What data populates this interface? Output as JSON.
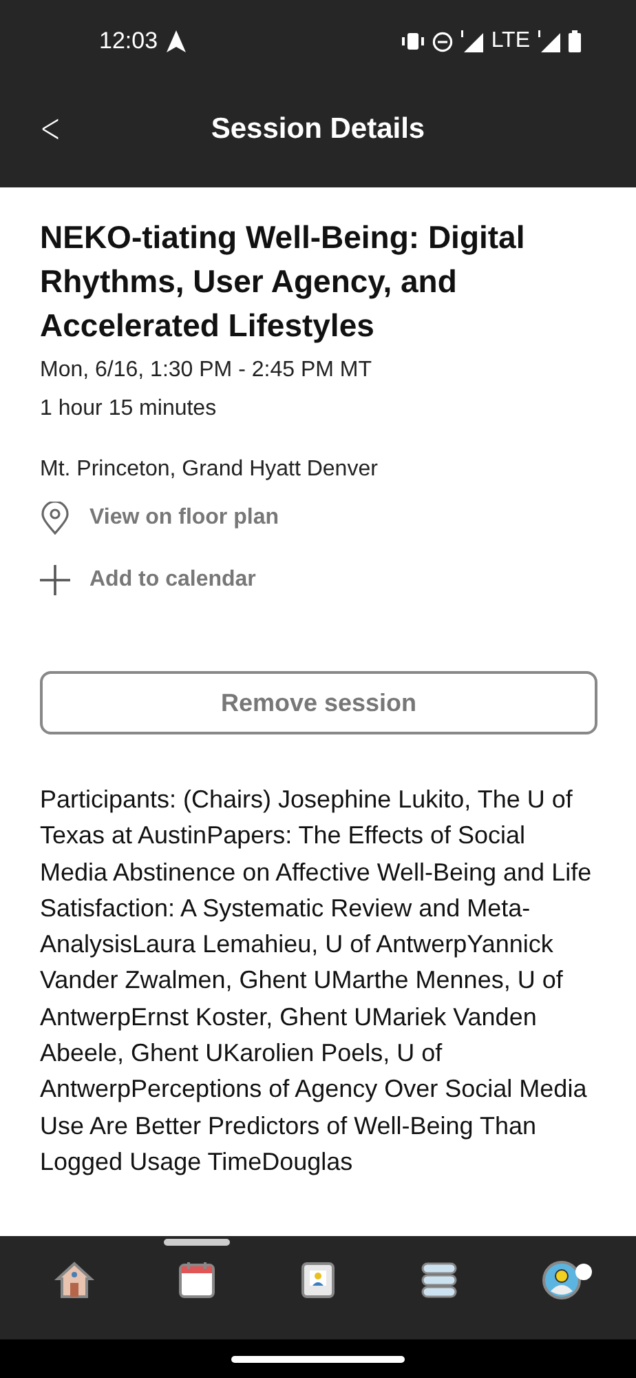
{
  "status_bar": {
    "time": "12:03",
    "network": "LTE"
  },
  "header": {
    "back": "<",
    "title": "Session Details"
  },
  "session": {
    "title": "NEKO-tiating Well-Being: Digital Rhythms, User Agency, and Accelerated Lifestyles",
    "time": "Mon, 6/16, 1:30 PM - 2:45 PM MT",
    "duration": "1 hour 15 minutes",
    "location": "Mt. Princeton, Grand Hyatt Denver"
  },
  "actions": [
    {
      "kind": "pin",
      "label": "View on floor plan"
    },
    {
      "kind": "plus",
      "label": "Add to calendar"
    }
  ],
  "remove_button": "Remove session",
  "participants": "Participants: (Chairs) Josephine Lukito, The U of Texas at AustinPapers: The Effects of Social Media Abstinence on Affective Well-Being and Life Satisfaction: A Systematic Review and Meta-AnalysisLaura Lemahieu, U of AntwerpYannick Vander Zwalmen, Ghent UMarthe Mennes, U of AntwerpErnst Koster, Ghent UMariek Vanden Abeele, Ghent UKarolien Poels, U of AntwerpPerceptions of Agency Over Social Media Use Are Better Predictors of Well-Being Than Logged Usage TimeDouglas",
  "nav": [
    {
      "kind": "home",
      "selected": false
    },
    {
      "kind": "calendar",
      "selected": true
    },
    {
      "kind": "badge",
      "selected": false
    },
    {
      "kind": "list",
      "selected": false
    },
    {
      "kind": "profile",
      "selected": false,
      "notification": true
    }
  ]
}
